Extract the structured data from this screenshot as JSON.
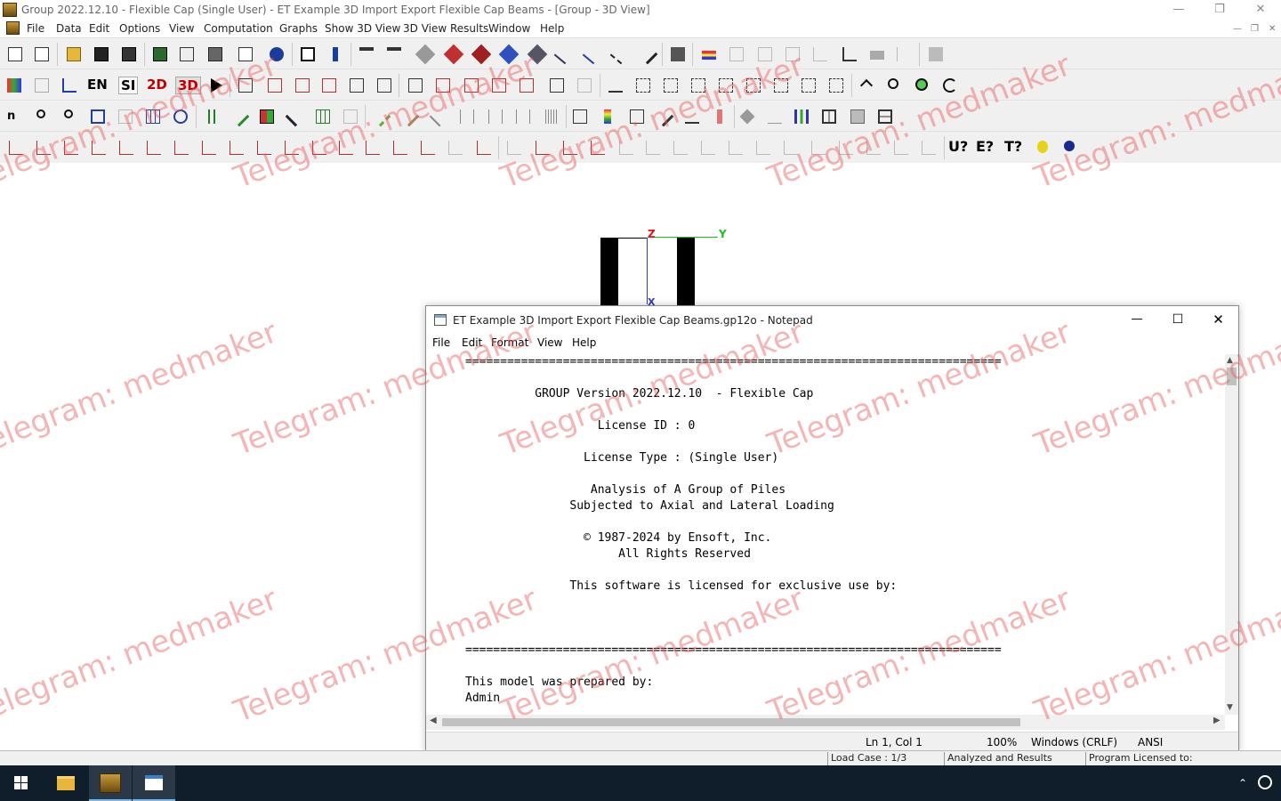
{
  "window": {
    "title": "Group 2022.12.10 - Flexible Cap (Single User) - ET Example 3D Import Export Flexible Cap Beams - [Group - 3D View]"
  },
  "menu": [
    "File",
    "Data",
    "Edit",
    "Options",
    "View",
    "Computation",
    "Graphs",
    "Show 3D View",
    "3D View Results",
    "Window",
    "Help"
  ],
  "toolbar2_text": {
    "en": "EN",
    "si": "SI",
    "two_d": "2D",
    "three_d": "3D"
  },
  "toolbar4_text": {
    "u": "U?",
    "e": "E?",
    "t": "T?"
  },
  "view3d": {
    "axis_z": "Z",
    "axis_y": "Y",
    "axis_x": "X"
  },
  "notepad": {
    "title": "ET Example 3D Import Export Flexible Cap Beams.gp12o - Notepad",
    "menu": [
      "File",
      "Edit",
      "Format",
      "View",
      "Help"
    ],
    "lines": [
      "=============================================================================",
      "",
      "          GROUP Version 2022.12.10  - Flexible Cap",
      "",
      "                   License ID : 0",
      "",
      "                 License Type : (Single User)",
      "",
      "                  Analysis of A Group of Piles",
      "               Subjected to Axial and Lateral Loading",
      "",
      "                 © 1987-2024 by Ensoft, Inc.",
      "                      All Rights Reserved",
      "",
      "               This software is licensed for exclusive use by:",
      "",
      "",
      "",
      "=============================================================================",
      "",
      "This model was prepared by:",
      "Admin"
    ],
    "status": {
      "position": "Ln 1, Col 1",
      "zoom": "100%",
      "eol": "Windows (CRLF)",
      "encoding": "ANSI"
    }
  },
  "app_status": {
    "load_case": "Load Case : 1/3",
    "state": "Analyzed and Results",
    "licensed": "Program Licensed to:"
  },
  "watermark": "Telegram: medmaker",
  "colors": {
    "accent": "#0078d7",
    "taskbar": "#101d2a",
    "watermark": "#eb5a5a"
  }
}
